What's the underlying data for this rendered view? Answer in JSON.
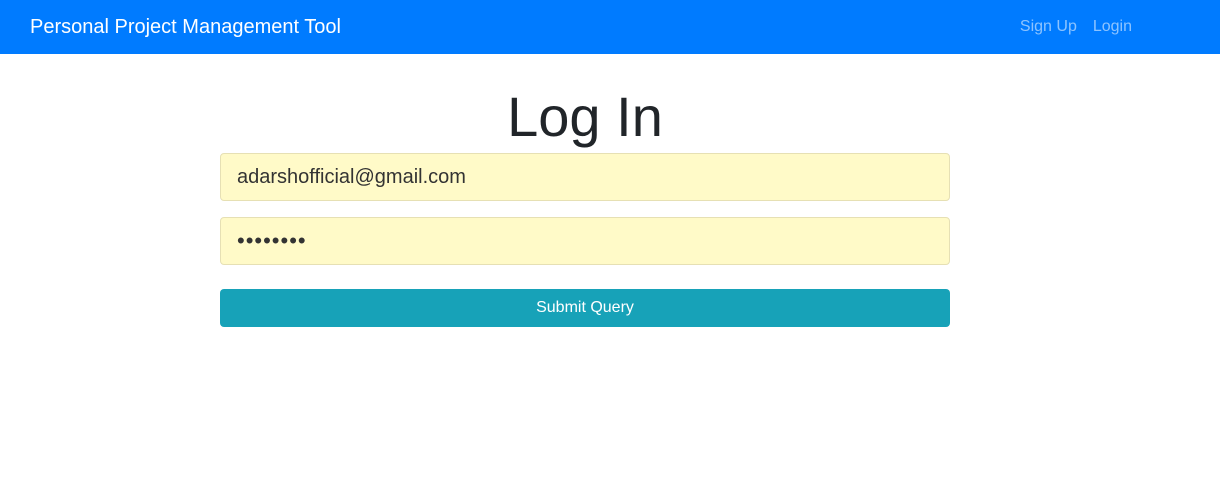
{
  "navbar": {
    "brand": "Personal Project Management Tool",
    "links": [
      {
        "label": "Sign Up"
      },
      {
        "label": "Login"
      }
    ]
  },
  "main": {
    "title": "Log In",
    "email_value": "adarshofficial@gmail.com",
    "password_value": "password",
    "submit_label": "Submit Query"
  },
  "colors": {
    "navbar_bg": "#007bff",
    "input_autofill_bg": "#fffac8",
    "submit_bg": "#17a2b8"
  }
}
